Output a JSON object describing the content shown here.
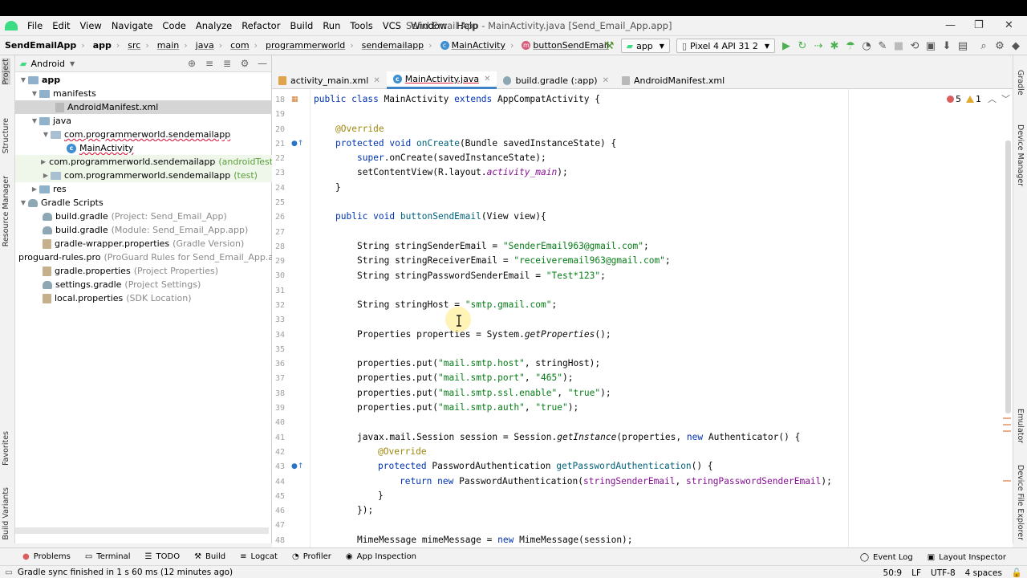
{
  "window": {
    "title": "Send Email App - MainActivity.java [Send_Email_App.app]",
    "menu": [
      "File",
      "Edit",
      "View",
      "Navigate",
      "Code",
      "Analyze",
      "Refactor",
      "Build",
      "Run",
      "Tools",
      "VCS",
      "Window",
      "Help"
    ]
  },
  "breadcrumb": {
    "project": "SendEmailApp",
    "items": [
      "app",
      "src",
      "main",
      "java",
      "com",
      "programmerworld",
      "sendemailapp",
      "MainActivity",
      "buttonSendEmail"
    ]
  },
  "toolbar": {
    "run_config": "app",
    "device": "Pixel 4 API 31 2"
  },
  "left_strip": [
    "Project",
    "Structure",
    "Resource Manager",
    "Favorites",
    "Build Variants"
  ],
  "right_strip": [
    "Gradle",
    "Device Manager",
    "Emulator",
    "Device File Explorer"
  ],
  "project_pane": {
    "view": "Android",
    "tree": [
      {
        "label": "app",
        "extra": ""
      },
      {
        "label": "manifests",
        "extra": ""
      },
      {
        "label": "AndroidManifest.xml",
        "extra": ""
      },
      {
        "label": "java",
        "extra": ""
      },
      {
        "label": "com.programmerworld.sendemailapp",
        "extra": ""
      },
      {
        "label": "MainActivity",
        "extra": ""
      },
      {
        "label": "com.programmerworld.sendemailapp",
        "extra": "(androidTest)"
      },
      {
        "label": "com.programmerworld.sendemailapp",
        "extra": "(test)"
      },
      {
        "label": "res",
        "extra": ""
      },
      {
        "label": "Gradle Scripts",
        "extra": ""
      },
      {
        "label": "build.gradle",
        "extra": "(Project: Send_Email_App)"
      },
      {
        "label": "build.gradle",
        "extra": "(Module: Send_Email_App.app)"
      },
      {
        "label": "gradle-wrapper.properties",
        "extra": "(Gradle Version)"
      },
      {
        "label": "proguard-rules.pro",
        "extra": "(ProGuard Rules for Send_Email_App.app)"
      },
      {
        "label": "gradle.properties",
        "extra": "(Project Properties)"
      },
      {
        "label": "settings.gradle",
        "extra": "(Project Settings)"
      },
      {
        "label": "local.properties",
        "extra": "(SDK Location)"
      }
    ]
  },
  "tabs": [
    "activity_main.xml",
    "MainActivity.java",
    "build.gradle (:app)",
    "AndroidManifest.xml"
  ],
  "inspections": {
    "errors": "5",
    "warnings": "1"
  },
  "line_numbers": [
    "18",
    "19",
    "20",
    "21",
    "22",
    "23",
    "24",
    "25",
    "26",
    "27",
    "28",
    "29",
    "30",
    "31",
    "32",
    "33",
    "34",
    "35",
    "36",
    "37",
    "38",
    "39",
    "40",
    "41",
    "42",
    "43",
    "44",
    "45",
    "46",
    "47",
    "48"
  ],
  "bottom_tools": [
    "Problems",
    "Terminal",
    "TODO",
    "Build",
    "Logcat",
    "Profiler",
    "App Inspection"
  ],
  "bottom_right_tools": [
    "Event Log",
    "Layout Inspector"
  ],
  "status": {
    "message": "Gradle sync finished in 1 s 60 ms (12 minutes ago)",
    "position": "50:9",
    "line_sep": "LF",
    "encoding": "UTF-8",
    "indent": "4 spaces"
  },
  "code": {
    "l18_kw1": "public class ",
    "l18_name": "MainActivity ",
    "l18_kw2": "extends ",
    "l18_rest": "AppCompatActivity {",
    "l20_ann": "@Override",
    "l21_kw": "protected void ",
    "l21_fn": "onCreate",
    "l21_rest": "(Bundle savedInstanceState) {",
    "l22_kw": "super",
    "l22_rest": ".onCreate(savedInstanceState);",
    "l23_a": "setContentView(R.layout.",
    "l23_field": "activity_main",
    "l23_b": ");",
    "l24": "}",
    "l26_kw": "public void ",
    "l26_fn": "buttonSendEmail",
    "l26_rest": "(View view){",
    "l28_a": "String stringSenderEmail = ",
    "l28_str": "\"SenderEmail963@gmail.com\"",
    "l28_b": ";",
    "l29_a": "String stringReceiverEmail = ",
    "l29_str": "\"receiveremail963@gmail.com\"",
    "l29_b": ";",
    "l30_a": "String stringPasswordSenderEmail = ",
    "l30_str": "\"Test*123\"",
    "l30_b": ";",
    "l32_a": "String stringHost = ",
    "l32_str": "\"smtp.gmail.com\"",
    "l32_b": ";",
    "l34_a": "Properties properties = System.",
    "l34_it": "getProperties",
    "l34_b": "();",
    "l36_a": "properties.put(",
    "l36_s1": "\"mail.smtp.host\"",
    "l36_b": ", stringHost);",
    "l37_a": "properties.put(",
    "l37_s1": "\"mail.smtp.port\"",
    "l37_m": ", ",
    "l37_s2": "\"465\"",
    "l37_b": ");",
    "l38_a": "properties.put(",
    "l38_s1": "\"mail.smtp.ssl.enable\"",
    "l38_m": ", ",
    "l38_s2": "\"true\"",
    "l38_b": ");",
    "l39_a": "properties.put(",
    "l39_s1": "\"mail.smtp.auth\"",
    "l39_m": ", ",
    "l39_s2": "\"true\"",
    "l39_b": ");",
    "l41_a": "javax.mail.Session session = Session.",
    "l41_it": "getInstance",
    "l41_m": "(properties, ",
    "l41_kw": "new ",
    "l41_b": "Authenticator() {",
    "l42_ann": "@Override",
    "l43_kw": "protected ",
    "l43_a": "PasswordAuthentication ",
    "l43_fn": "getPasswordAuthentication",
    "l43_b": "() {",
    "l44_kw": "return new ",
    "l44_a": "PasswordAuthentication(",
    "l44_p1": "stringSenderEmail",
    "l44_m": ", ",
    "l44_p2": "stringPasswordSenderEmail",
    "l44_b": ");",
    "l45": "}",
    "l46": "});",
    "l48_a": "MimeMessage mimeMessage = ",
    "l48_kw": "new ",
    "l48_b": "MimeMessage(session);"
  },
  "colors": {
    "accent": "#4083c9",
    "keyword": "#0033b3",
    "string": "#067d17",
    "annotation": "#9e880d"
  }
}
